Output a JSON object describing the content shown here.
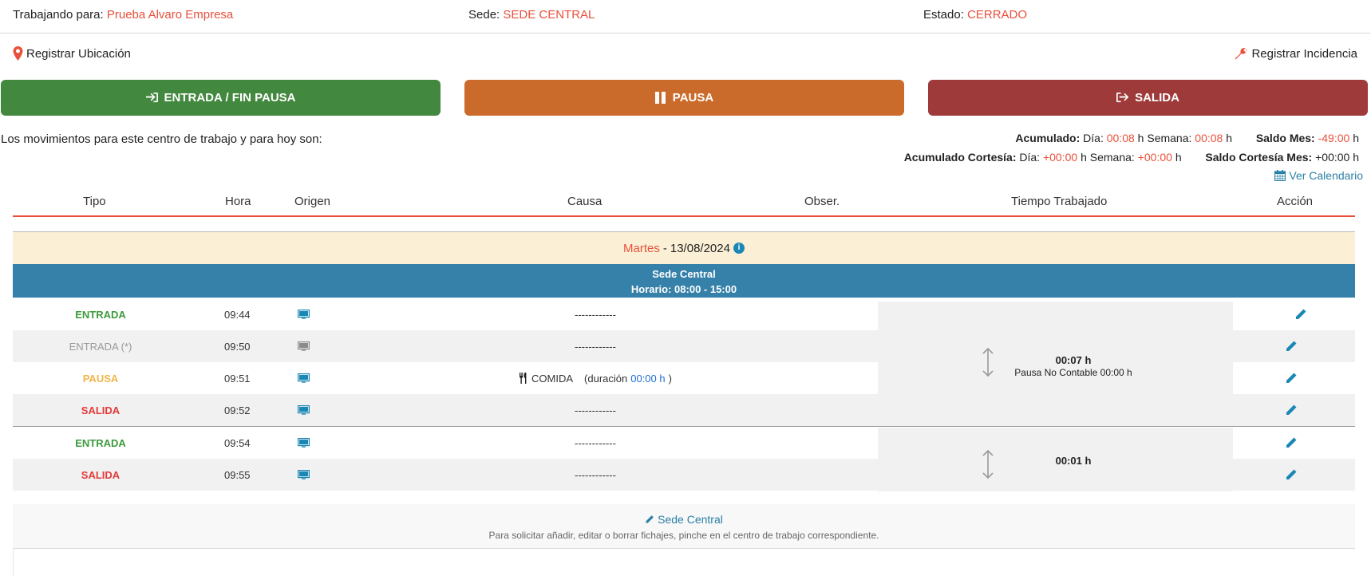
{
  "header": {
    "working_for_label": "Trabajando para:",
    "working_for_value": "Prueba Alvaro Empresa",
    "site_label": "Sede:",
    "site_value": "SEDE CENTRAL",
    "state_label": "Estado:",
    "state_value": "CERRADO"
  },
  "actions": {
    "register_location": "Registrar Ubicación",
    "register_incident": "Registrar Incidencia"
  },
  "buttons": {
    "entrada": "ENTRADA / FIN PAUSA",
    "pausa": "PAUSA",
    "salida": "SALIDA"
  },
  "colors": {
    "green": "#43883f",
    "orange": "#cb6b2b",
    "red": "#9e3a3a",
    "accent_red": "#e8503a",
    "blue_bar": "#3681a9"
  },
  "intro_text": "Los movimientos para este centro de trabajo y para hoy son:",
  "accumulated": {
    "label": "Acumulado:",
    "dia_label": "Día:",
    "dia_value": "00:08",
    "h1": "h",
    "semana_label": "Semana:",
    "semana_value": "00:08",
    "h2": "h",
    "saldo_label": "Saldo Mes:",
    "saldo_value": "-49:00",
    "h3": "h"
  },
  "courtesy": {
    "label": "Acumulado Cortesía:",
    "dia_label": "Día:",
    "dia_value": "+00:00",
    "h1": "h",
    "semana_label": "Semana:",
    "semana_value": "+00:00",
    "h2": "h",
    "saldo_label": "Saldo Cortesía Mes:",
    "saldo_value": "+00:00 h"
  },
  "calendar_link": "Ver Calendario",
  "table": {
    "columns": [
      "Tipo",
      "Hora",
      "Origen",
      "Causa",
      "Obser.",
      "Tiempo Trabajado",
      "Acción"
    ],
    "day_name": "Martes",
    "day_sep": "-",
    "day_date": "13/08/2024",
    "sede_name": "Sede Central",
    "sede_schedule": "Horario: 08:00 - 15:00",
    "rows": [
      {
        "tipo": "ENTRADA",
        "hora": "09:44",
        "causa": "------------"
      },
      {
        "tipo": "ENTRADA (*)",
        "hora": "09:50",
        "causa": "------------"
      },
      {
        "tipo": "PAUSA",
        "hora": "09:51",
        "causa_label": "COMIDA",
        "causa_dur_open": "(duración",
        "causa_dur": "00:00 h",
        "causa_dur_close": ")"
      },
      {
        "tipo": "SALIDA",
        "hora": "09:52",
        "causa": "------------"
      },
      {
        "tipo": "ENTRADA",
        "hora": "09:54",
        "causa": "------------"
      },
      {
        "tipo": "SALIDA",
        "hora": "09:55",
        "causa": "------------"
      }
    ],
    "worked_1": {
      "total": "00:07 h",
      "note": "Pausa No Contable 00:00 h"
    },
    "worked_2": {
      "total": "00:01 h"
    }
  },
  "footer": {
    "link": "Sede Central",
    "note": "Para solicitar añadir, editar o borrar fichajes, pinche en el centro de trabajo correspondiente."
  }
}
